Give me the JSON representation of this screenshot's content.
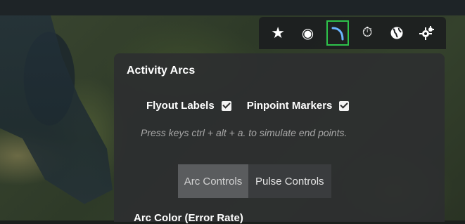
{
  "toolbar": {
    "tools": [
      {
        "icon": "star-icon",
        "glyph": "★"
      },
      {
        "icon": "target-icon",
        "glyph": "◉"
      },
      {
        "icon": "arc-icon",
        "glyph": ""
      },
      {
        "icon": "stopwatch-icon",
        "glyph": "⏱"
      },
      {
        "icon": "globe-icon",
        "glyph": ""
      },
      {
        "icon": "settings-icon",
        "glyph": ""
      }
    ],
    "active_index": 2,
    "active_color": "#2ec24b"
  },
  "panel": {
    "title": "Activity Arcs",
    "options": [
      {
        "label": "Flyout Labels",
        "checked": true
      },
      {
        "label": "Pinpoint Markers",
        "checked": true
      }
    ],
    "hint": "Press keys ctrl + alt + a. to simulate end points.",
    "tabs": [
      {
        "label": "Arc Controls",
        "selected": true
      },
      {
        "label": "Pulse Controls",
        "selected": false
      }
    ],
    "section_title": "Arc Color (Error Rate)"
  }
}
